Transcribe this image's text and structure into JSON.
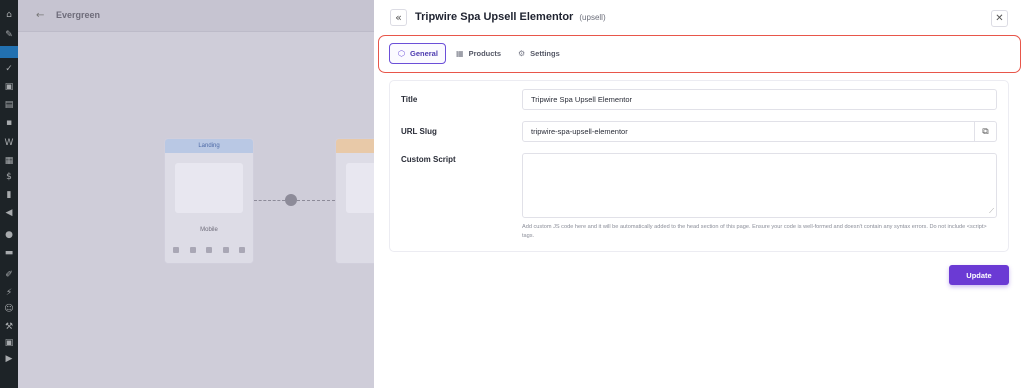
{
  "background_flow": {
    "flow_name": "Evergreen",
    "nodes": [
      {
        "header": "Landing",
        "label": "Mobile"
      },
      {
        "header": "",
        "label": ""
      }
    ]
  },
  "drawer": {
    "collapse_icon": "double-chevron-left-icon",
    "title": "Tripwire Spa Upsell Elementor",
    "step_type": "(upsell)",
    "close_icon": "close-icon",
    "tabs": [
      {
        "label": "General",
        "icon": "hexagon-icon",
        "active": true
      },
      {
        "label": "Products",
        "icon": "grid-icon",
        "active": false
      },
      {
        "label": "Settings",
        "icon": "gear-icon",
        "active": false
      }
    ],
    "form": {
      "title_label": "Title",
      "title_value": "Tripwire Spa Upsell Elementor",
      "slug_label": "URL Slug",
      "slug_value": "tripwire-spa-upsell-elementor",
      "copy_icon": "copy-icon",
      "script_label": "Custom Script",
      "script_value": "",
      "script_help": "Add custom JS code here and it will be automatically added to the head section of this page. Ensure your code is well-formed and doesn't contain any syntax errors. Do not include <script> tags."
    },
    "update_label": "Update"
  },
  "colors": {
    "accent": "#6b3ad4",
    "highlight_border": "#e8564a",
    "wp_sidebar": "#1d2327"
  }
}
